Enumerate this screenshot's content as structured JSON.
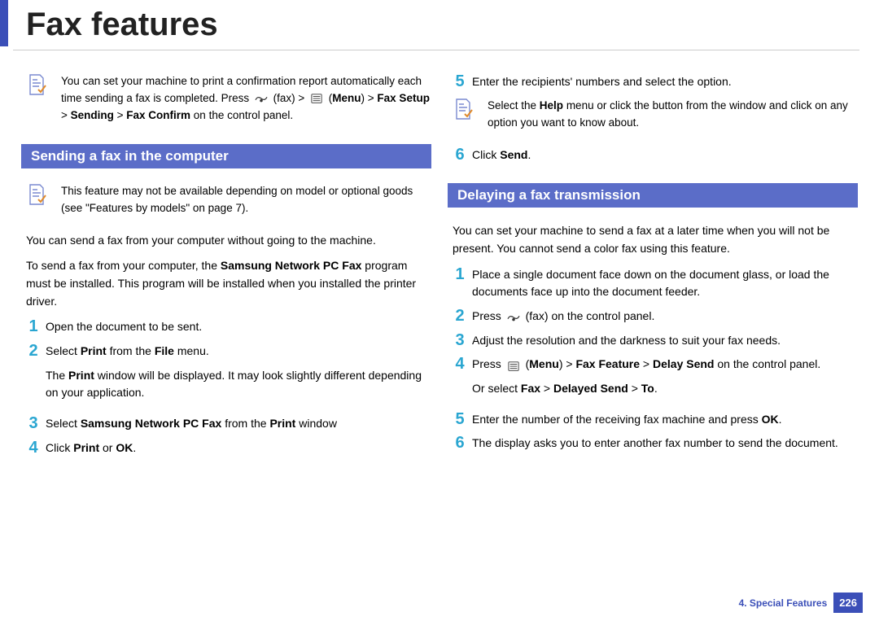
{
  "title": "Fax features",
  "left": {
    "note1_a": "You can set your machine to print a confirmation report automatically each time sending a fax is completed. Press ",
    "note1_b": " (fax) > ",
    "note1_menu": "Menu",
    "note1_sep1": ") > ",
    "note1_faxsetup": "Fax Setup",
    "note1_c": " > ",
    "note1_sending": "Sending",
    "note1_sep2": " > ",
    "note1_confirm": "Fax Confirm",
    "note1_d": " on the control panel.",
    "section1": "Sending a fax in the computer",
    "note2": "This feature may not be available depending on model or optional goods (see \"Features by models\" on page 7).",
    "body1": "You can send a fax from your computer without going to the machine.",
    "body2_a": "To send a fax from your computer, the ",
    "body2_b": "Samsung Network PC Fax",
    "body2_c": " program must be installed. This program will be installed when you installed the printer driver.",
    "s1": "Open the document to be sent.",
    "s2_a": "Select ",
    "s2_b": "Print",
    "s2_c": " from the ",
    "s2_d": "File",
    "s2_e": " menu.",
    "s2_f": "The ",
    "s2_g": "Print",
    "s2_h": " window will be displayed. It may look slightly different depending on your application.",
    "s3_a": "Select ",
    "s3_b": "Samsung Network PC Fax",
    "s3_c": " from the ",
    "s3_d": "Print",
    "s3_e": " window",
    "s4_a": "Click ",
    "s4_b": "Print",
    "s4_c": " or ",
    "s4_d": "OK",
    "s4_e": "."
  },
  "right": {
    "s5": "Enter the recipients' numbers and select the option.",
    "note3_a": "Select the ",
    "note3_b": "Help",
    "note3_c": " menu or click the      button from the window and click on any option you want to know about.",
    "s6_a": "Click ",
    "s6_b": "Send",
    "s6_c": ".",
    "section2": "Delaying a fax transmission",
    "body3": "You can set your machine to send a fax at a later time when you will not be present. You cannot send a color fax using this feature.",
    "d1": "Place a single document face down on the document glass, or load the documents face up into the document feeder.",
    "d2_a": "Press ",
    "d2_b": " (fax) on the control panel.",
    "d3": "Adjust the resolution and the darkness to suit your fax needs.",
    "d4_a": "Press ",
    "d4_menu": "Menu",
    "d4_sep1": ") > ",
    "d4_ff": "Fax Feature",
    "d4_sep2": " > ",
    "d4_ds": "Delay Send",
    "d4_b": " on the control panel.",
    "d4_c": "Or select ",
    "d4_d": "Fax",
    "d4_sep3": " > ",
    "d4_e": "Delayed Send",
    "d4_sep4": " > ",
    "d4_f": "To",
    "d4_g": ".",
    "d5_a": "Enter the number of the receiving fax machine and press ",
    "d5_b": "OK",
    "d5_c": ".",
    "d6": "The display asks you to enter another fax number to send the document."
  },
  "footer": {
    "chapter": "4.  Special Features",
    "page": "226"
  }
}
